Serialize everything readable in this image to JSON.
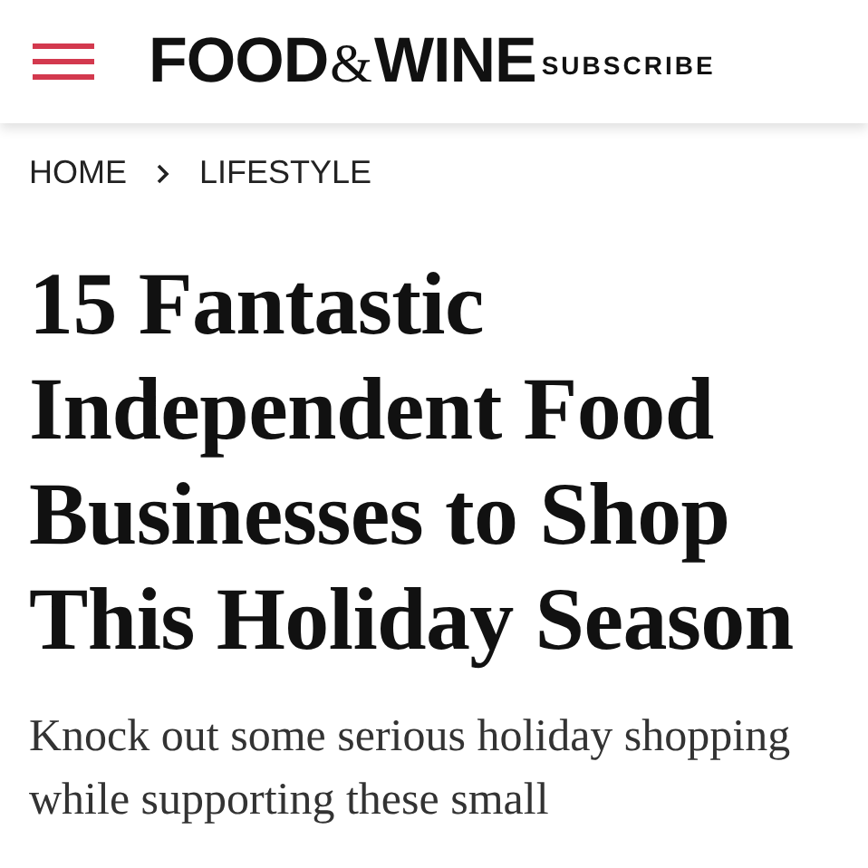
{
  "header": {
    "logo": [
      "FOOD",
      "&",
      "WINE"
    ],
    "subscribe": "SUBSCRIBE"
  },
  "breadcrumb": [
    "HOME",
    "LIFESTYLE"
  ],
  "title": "15 Fantastic Independent Food Businesses to Shop This Holiday Season",
  "intro": "Knock out some serious holiday shopping while supporting these small"
}
